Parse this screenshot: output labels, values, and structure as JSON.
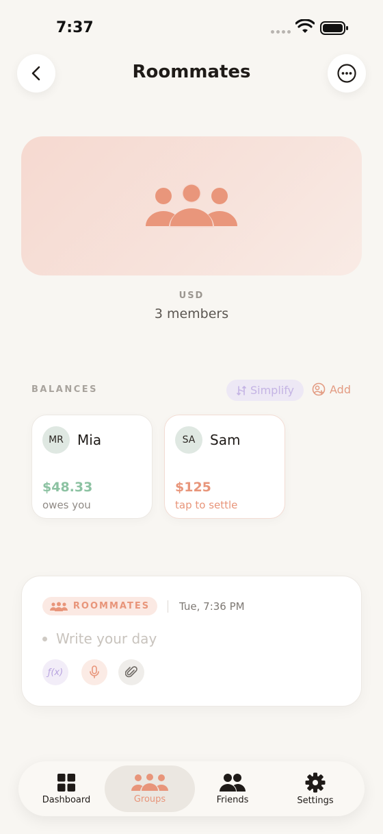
{
  "status_bar": {
    "time": "7:37"
  },
  "header": {
    "title": "Roommates"
  },
  "group": {
    "currency": "USD",
    "members_text": "3 members"
  },
  "balances": {
    "label": "BALANCES",
    "simplify_label": "Simplify",
    "add_label": "Add",
    "cards": [
      {
        "initials": "MR",
        "name": "Mia",
        "amount": "$48.33",
        "subtext": "owes you",
        "tone": "positive"
      },
      {
        "initials": "SA",
        "name": "Sam",
        "amount": "$125",
        "subtext": "tap to settle",
        "tone": "negative"
      }
    ]
  },
  "journal": {
    "group_chip": "ROOMMATES",
    "date": "Tue, 7:36 PM",
    "placeholder": "Write your day",
    "value": ""
  },
  "tab_bar": {
    "items": [
      {
        "label": "Dashboard",
        "icon": "grid-icon",
        "active": false
      },
      {
        "label": "Groups",
        "icon": "people-group-icon",
        "active": true
      },
      {
        "label": "Friends",
        "icon": "friends-icon",
        "active": false
      },
      {
        "label": "Settings",
        "icon": "gear-icon",
        "active": false
      }
    ]
  },
  "colors": {
    "background": "#f8f6f2",
    "accent_orange": "#e8957a",
    "positive_green": "#8cc2a2",
    "simplify_purple": "#c4b4e4",
    "hero_pink": "#f6d9d0"
  }
}
